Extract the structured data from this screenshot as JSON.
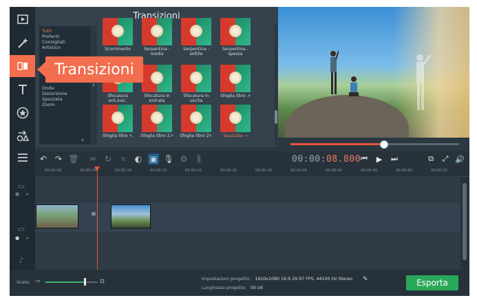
{
  "panel": {
    "title": "Transizioni",
    "categories": [
      "Tutti",
      "Preferiti",
      "Consigliati",
      "Artistico",
      "Onda",
      "Distorsione",
      "Spazzata",
      "Zoom"
    ],
    "selected_category": "Tutti",
    "transitions": [
      {
        "label": "Scorrimento",
        "selected": false
      },
      {
        "label": "Serpentina - media",
        "selected": false
      },
      {
        "label": "Serpentina - sottile",
        "selected": false
      },
      {
        "label": "Serpentina - spessa",
        "selected": false
      },
      {
        "label": "Sfocatura ent./usc.",
        "selected": false
      },
      {
        "label": "Sfocatura in entrata",
        "selected": false
      },
      {
        "label": "Sfocatura in uscita",
        "selected": false
      },
      {
        "label": "Sfoglia libro ↗",
        "selected": false
      },
      {
        "label": "Sfoglia libro ↖",
        "selected": false
      },
      {
        "label": "Sfoglia libro 2↗",
        "selected": false
      },
      {
        "label": "Sfoglia libro 2↖",
        "selected": false
      },
      {
        "label": "Spazzata →",
        "selected": true
      }
    ]
  },
  "tooltip": {
    "text": "Transizioni"
  },
  "player": {
    "timecode_main": "00:00:",
    "timecode_ms": "08.800",
    "progress": 0.55
  },
  "ruler": {
    "ticks": [
      "00:00:00",
      "00:00:05",
      "00:00:10",
      "00:00:15",
      "00:00:20",
      "00:00:25",
      "00:00:30",
      "00:00:35",
      "00:00:40",
      "00:00:45",
      "00:00:50",
      "00:00:55"
    ]
  },
  "status": {
    "scale_label": "Scala:",
    "scale_value": 0.75,
    "settings_label": "Impostazioni progetto:",
    "settings_value": "1920x1080 16:9 29.97 FPS, 44100 Hz Stereo",
    "length_label": "Lunghezza progetto:",
    "length_value": "00:16",
    "export_label": "Esporta"
  },
  "colors": {
    "accent": "#f26e4e",
    "export": "#2aa85a",
    "playhead": "#e8553e"
  },
  "icons": {
    "left_tools": [
      "import-media-icon",
      "magic-wand-icon",
      "transitions-icon",
      "text-icon",
      "stickers-icon",
      "shapes-icon",
      "menu-icon"
    ],
    "toolbar": [
      "undo-icon",
      "redo-icon",
      "delete-icon",
      "cut-icon",
      "rotate-icon",
      "crop-icon",
      "color-adjust-icon",
      "image-icon",
      "microphone-icon",
      "settings-icon",
      "equalizer-icon"
    ],
    "playback": [
      "previous-frame-icon",
      "play-icon",
      "next-frame-icon",
      "detach-preview-icon",
      "fullscreen-icon",
      "volume-icon"
    ]
  }
}
